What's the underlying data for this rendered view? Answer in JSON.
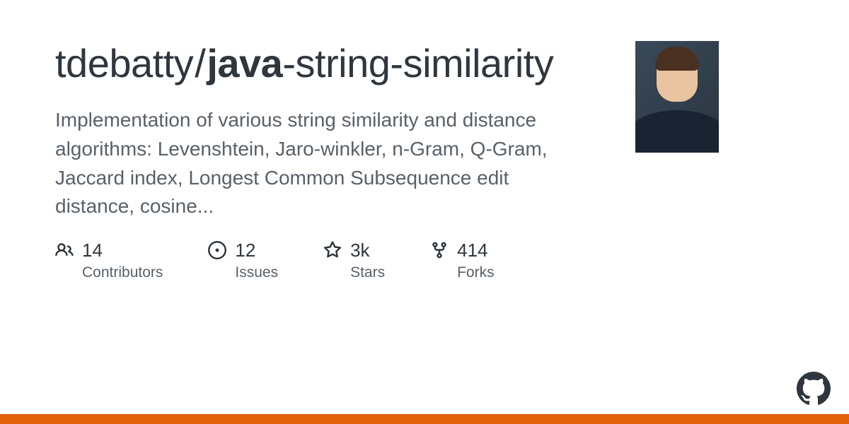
{
  "repo": {
    "owner": "tdebatty",
    "name_bold": "java",
    "name_rest": "-string-similarity",
    "description": "Implementation of various string similarity and distance algorithms: Levenshtein, Jaro-winkler, n-Gram, Q-Gram, Jaccard index, Longest Common Subsequence edit distance, cosine..."
  },
  "stats": {
    "contributors": {
      "value": "14",
      "label": "Contributors"
    },
    "issues": {
      "value": "12",
      "label": "Issues"
    },
    "stars": {
      "value": "3k",
      "label": "Stars"
    },
    "forks": {
      "value": "414",
      "label": "Forks"
    }
  },
  "colors": {
    "language_bar": "#e36209"
  }
}
